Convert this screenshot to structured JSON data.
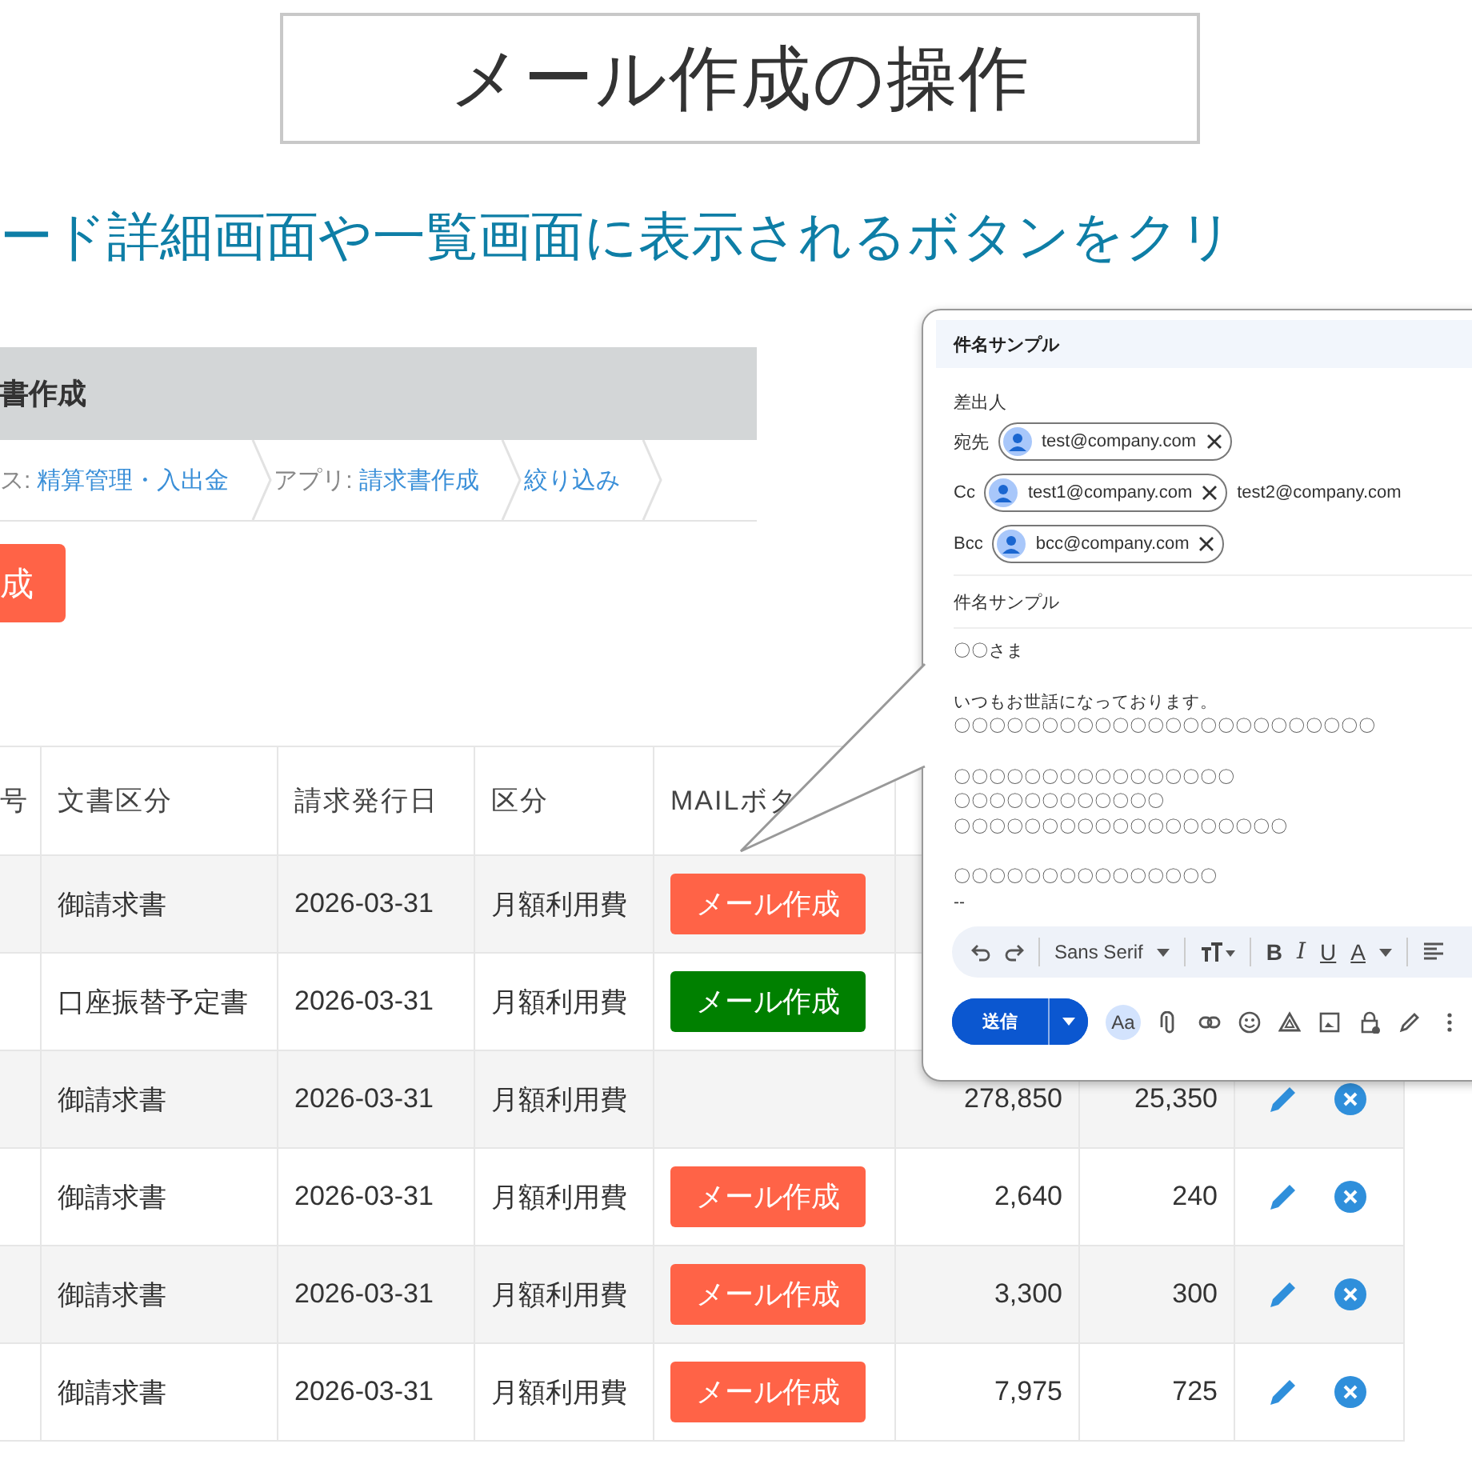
{
  "slide": {
    "title": "メール作成の操作",
    "subtitle": "ード詳細画面や一覧画面に表示されるボタンをクリ"
  },
  "app": {
    "header": "書作成",
    "breadcrumbs": [
      {
        "label": "ス:",
        "value": "精算管理・入出金"
      },
      {
        "label": "アプリ:",
        "value": "請求書作成"
      },
      {
        "value": "絞り込み"
      }
    ],
    "create_button": "成"
  },
  "table": {
    "columns": [
      "号",
      "文書区分",
      "請求発行日",
      "区分",
      "MAILボタ"
    ],
    "rows": [
      {
        "doc_type": "御請求書",
        "date": "2026-03-31",
        "category": "月額利用費",
        "mail_button": {
          "label": "メール作成",
          "color": "#ff6347"
        }
      },
      {
        "doc_type": "口座振替予定書",
        "date": "2026-03-31",
        "category": "月額利用費",
        "mail_button": {
          "label": "メール作成",
          "color": "#008000"
        }
      },
      {
        "doc_type": "御請求書",
        "date": "2026-03-31",
        "category": "月額利用費",
        "amount": "278,850",
        "tax": "25,350"
      },
      {
        "doc_type": "御請求書",
        "date": "2026-03-31",
        "category": "月額利用費",
        "mail_button": {
          "label": "メール作成",
          "color": "#ff6347"
        },
        "amount": "2,640",
        "tax": "240"
      },
      {
        "doc_type": "御請求書",
        "date": "2026-03-31",
        "category": "月額利用費",
        "mail_button": {
          "label": "メール作成",
          "color": "#ff6347"
        },
        "amount": "3,300",
        "tax": "300"
      },
      {
        "doc_type": "御請求書",
        "date": "2026-03-31",
        "category": "月額利用費",
        "mail_button": {
          "label": "メール作成",
          "color": "#ff6347"
        },
        "amount": "7,975",
        "tax": "725"
      }
    ]
  },
  "mail_popup": {
    "title": "件名サンプル",
    "from_label": "差出人",
    "recipients": [
      {
        "label": "宛先",
        "chips": [
          "test@company.com"
        ]
      },
      {
        "label": "Cc",
        "chips": [
          "test1@company.com"
        ],
        "text": "test2@company.com"
      },
      {
        "label": "Bcc",
        "chips": [
          "bcc@company.com"
        ]
      }
    ],
    "subject": "件名サンプル",
    "body": [
      [
        "〇〇さま"
      ],
      [
        "いつもお世話になっております。",
        "〇〇〇〇〇〇〇〇〇〇〇〇〇〇〇〇〇〇〇〇〇〇〇〇"
      ],
      [
        "〇〇〇〇〇〇〇〇〇〇〇〇〇〇〇〇",
        "〇〇〇〇〇〇〇〇〇〇〇〇",
        "〇〇〇〇〇〇〇〇〇〇〇〇〇〇〇〇〇〇〇"
      ],
      [
        "〇〇〇〇〇〇〇〇〇〇〇〇〇〇〇",
        "--"
      ]
    ],
    "toolbar": {
      "font": "Sans Serif",
      "bold": "B",
      "italic": "I",
      "underline": "U",
      "text_color": "A"
    },
    "send_button": "送信",
    "aa_button": "Aa"
  }
}
